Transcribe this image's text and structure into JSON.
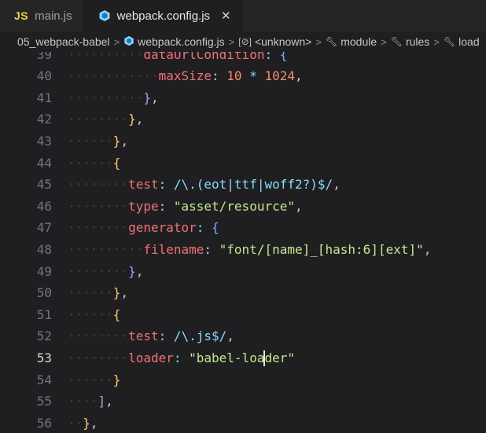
{
  "tabs": [
    {
      "icon": "JS",
      "label": "main.js",
      "active": false
    },
    {
      "icon": "webpack-icon",
      "label": "webpack.config.js",
      "active": true,
      "close": "✕"
    }
  ],
  "breadcrumb": [
    {
      "label": "05_webpack-babel",
      "icon": ""
    },
    {
      "label": "webpack.config.js",
      "icon": "webpack-icon"
    },
    {
      "label": "<unknown>",
      "icon": "symbol-icon"
    },
    {
      "label": "module",
      "icon": "wrench-icon"
    },
    {
      "label": "rules",
      "icon": "wrench-icon"
    },
    {
      "label": "load",
      "icon": "wrench-icon"
    }
  ],
  "editor": {
    "active_line": 53,
    "lines": [
      {
        "n": "39",
        "text": "dataUrlCondition: {"
      },
      {
        "n": "40",
        "text": "maxSize: 10 * 1024,"
      },
      {
        "n": "41",
        "text": "},"
      },
      {
        "n": "42",
        "text": "},"
      },
      {
        "n": "43",
        "text": "},"
      },
      {
        "n": "44",
        "text": "{"
      },
      {
        "n": "45",
        "text": "test: /\\.(eot|ttf|woff2?)$/,"
      },
      {
        "n": "46",
        "text": "type: \"asset/resource\","
      },
      {
        "n": "47",
        "text": "generator: {"
      },
      {
        "n": "48",
        "text": "filename: \"font/[name]_[hash:6][ext]\","
      },
      {
        "n": "49",
        "text": "},"
      },
      {
        "n": "50",
        "text": "},"
      },
      {
        "n": "51",
        "text": "{"
      },
      {
        "n": "52",
        "text": "test: /\\.js$/,"
      },
      {
        "n": "53",
        "text": "loader: \"babel-loader\""
      },
      {
        "n": "54",
        "text": "}"
      },
      {
        "n": "55",
        "text": "],"
      },
      {
        "n": "56",
        "text": "},"
      }
    ]
  }
}
